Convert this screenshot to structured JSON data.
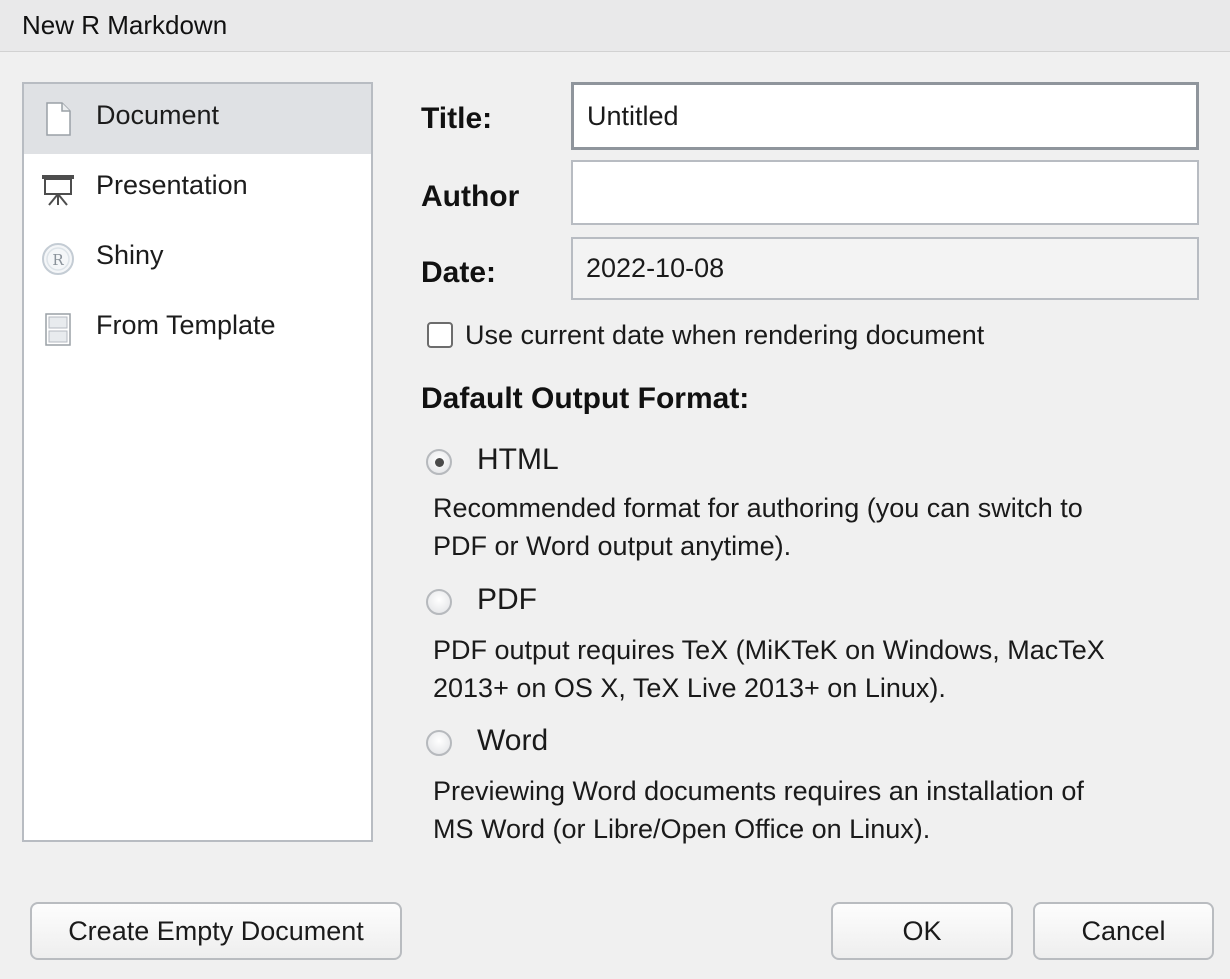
{
  "window": {
    "title": "New R Markdown"
  },
  "sidebar": {
    "items": [
      {
        "label": "Document",
        "icon": "document-icon",
        "selected": true
      },
      {
        "label": "Presentation",
        "icon": "presentation-easel-icon",
        "selected": false
      },
      {
        "label": "Shiny",
        "icon": "shiny-r-icon",
        "selected": false
      },
      {
        "label": "From Template",
        "icon": "template-icon",
        "selected": false
      }
    ]
  },
  "form": {
    "title_label": "Title:",
    "title_value": "Untitled",
    "author_label": "Author",
    "author_value": "",
    "date_label": "Date:",
    "date_value": "2022-10-08",
    "use_current_date_label": "Use current date when rendering document",
    "use_current_date_checked": false
  },
  "output_format": {
    "heading": "Dafault Output Format:",
    "options": [
      {
        "label": "HTML",
        "selected": true,
        "description_line1": "Recommended format for authoring (you can switch to",
        "description_line2": "PDF or Word output anytime)."
      },
      {
        "label": "PDF",
        "selected": false,
        "description_line1": "PDF output requires TeX (MiKTeK on Windows, MacTeX",
        "description_line2": "2013+ on OS X, TeX Live 2013+ on Linux)."
      },
      {
        "label": "Word",
        "selected": false,
        "description_line1": "Previewing Word documents requires an installation of",
        "description_line2": "MS Word (or Libre/Open Office on Linux)."
      }
    ]
  },
  "buttons": {
    "create_empty": "Create Empty Document",
    "ok": "OK",
    "cancel": "Cancel"
  }
}
